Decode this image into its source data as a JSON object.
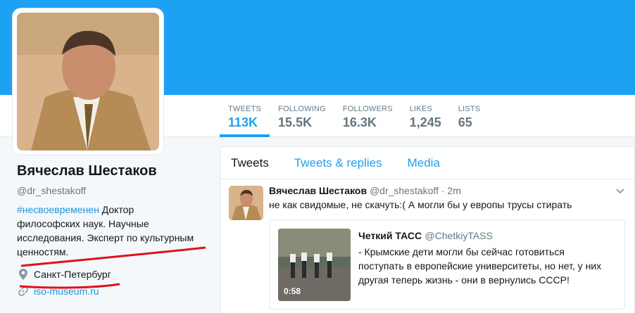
{
  "profile": {
    "name": "Вячеслав Шестаков",
    "handle": "@dr_shestakoff",
    "bio_hashtag": "#несвоевременен",
    "bio_line1": " Доктор",
    "bio_line2": "философских наук. Научные",
    "bio_line3": "исследования. Эксперт по культурным",
    "bio_line4": "ценностям.",
    "location": "Санкт-Петербург",
    "website": "iso-museum.ru"
  },
  "stats": [
    {
      "label": "TWEETS",
      "value": "113K"
    },
    {
      "label": "FOLLOWING",
      "value": "15.5K"
    },
    {
      "label": "FOLLOWERS",
      "value": "16.3K"
    },
    {
      "label": "LIKES",
      "value": "1,245"
    },
    {
      "label": "LISTS",
      "value": "65"
    }
  ],
  "tabs": {
    "tweets": "Tweets",
    "replies": "Tweets & replies",
    "media": "Media"
  },
  "tweet": {
    "name": "Вячеслав Шестаков",
    "handle": "@dr_shestakoff",
    "dot": "·",
    "time": "2m",
    "text": "не как свидомые, не скачуть:( А могли бы у европы трусы стирать"
  },
  "quote": {
    "name": "Четкий ТАСС",
    "handle": "@ChetkiyTASS",
    "line1": "- Крымские дети могли бы сейчас готовиться",
    "line2": "поступать в европейские университеты, но нет, у них",
    "line3": "другая теперь жизнь - они в вернулись СССР!",
    "duration": "0:58"
  },
  "icons": {
    "location": "map-pin-icon",
    "website": "link-icon",
    "caret": "chevron-down-icon"
  },
  "colors": {
    "banner": "#1da1f2",
    "link": "#1b95e0",
    "annotation": "#e0101a"
  }
}
